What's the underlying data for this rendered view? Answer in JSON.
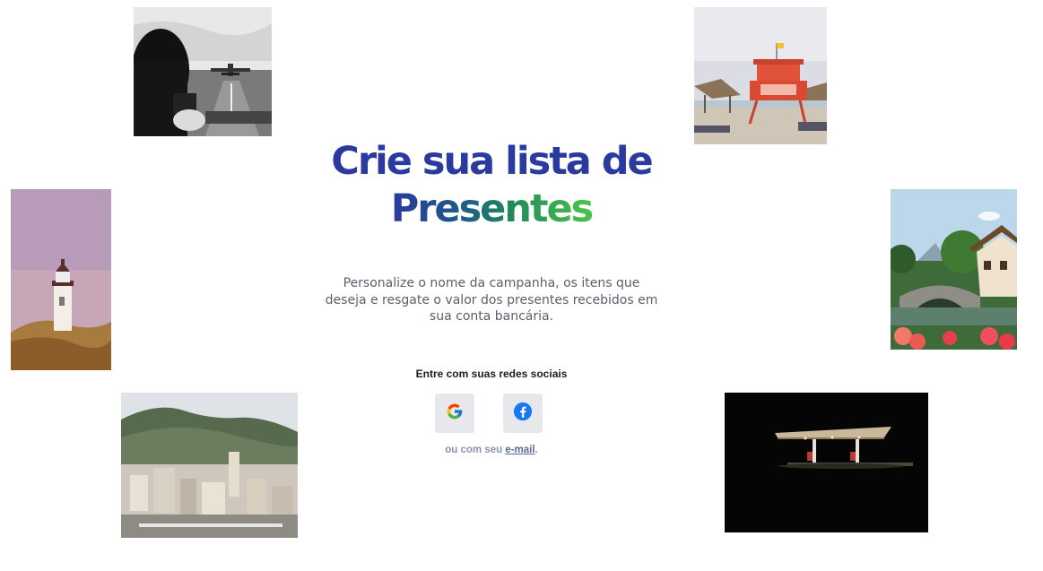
{
  "hero": {
    "title_line1": "Crie sua lista de",
    "title_line2": "Presentes",
    "subtitle": "Personalize o nome da campanha, os itens que deseja e resgate o valor dos presentes recebidos em sua conta bancária."
  },
  "social": {
    "label": "Entre com suas redes sociais",
    "buttons": [
      {
        "icon": "google-icon"
      },
      {
        "icon": "facebook-icon"
      }
    ]
  },
  "alt_login": {
    "prefix": "ou com seu ",
    "link": "e-mail",
    "suffix": "."
  },
  "colors": {
    "title": "#2b3a9e",
    "gradient_start": "#2b3a9e",
    "gradient_end": "#4cc44a",
    "subtitle": "#5a5f6c",
    "button_bg": "#e7e8eb",
    "facebook": "#1877f2"
  }
}
